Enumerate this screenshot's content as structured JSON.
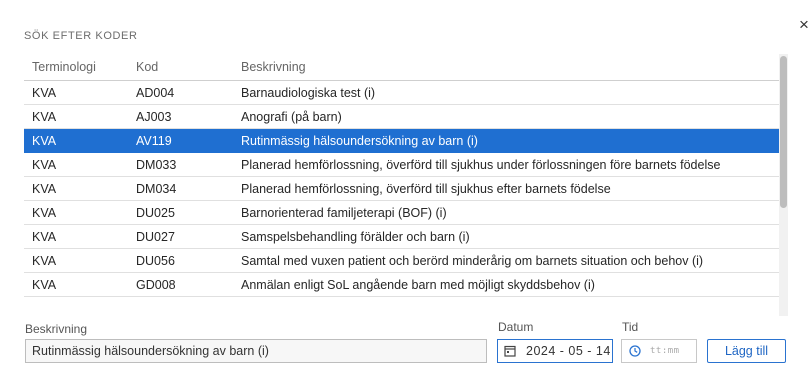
{
  "dialog": {
    "close_glyph": "×",
    "heading": "SÖK EFTER KODER"
  },
  "table": {
    "columns": [
      "Terminologi",
      "Kod",
      "Beskrivning"
    ],
    "selected_index": 2,
    "rows": [
      {
        "terminologi": "KVA",
        "kod": "AD004",
        "beskrivning": "Barnaudiologiska test (i)"
      },
      {
        "terminologi": "KVA",
        "kod": "AJ003",
        "beskrivning": "Anografi (på barn)"
      },
      {
        "terminologi": "KVA",
        "kod": "AV119",
        "beskrivning": "Rutinmässig hälsoundersökning av barn (i)"
      },
      {
        "terminologi": "KVA",
        "kod": "DM033",
        "beskrivning": "Planerad hemförlossning, överförd till sjukhus under förlossningen före barnets födelse"
      },
      {
        "terminologi": "KVA",
        "kod": "DM034",
        "beskrivning": "Planerad hemförlossning, överförd till sjukhus efter barnets födelse"
      },
      {
        "terminologi": "KVA",
        "kod": "DU025",
        "beskrivning": "Barnorienterad familjeterapi (BOF) (i)"
      },
      {
        "terminologi": "KVA",
        "kod": "DU027",
        "beskrivning": "Samspelsbehandling förälder och barn (i)"
      },
      {
        "terminologi": "KVA",
        "kod": "DU056",
        "beskrivning": "Samtal med vuxen patient och berörd minderårig om barnets situation och behov (i)"
      },
      {
        "terminologi": "KVA",
        "kod": "GD008",
        "beskrivning": "Anmälan enligt SoL angående barn med möjligt skyddsbehov (i)"
      }
    ]
  },
  "form": {
    "description_label": "Beskrivning",
    "description_value": "Rutinmässig hälsoundersökning av barn (i)",
    "date_label": "Datum",
    "date_value": "2024-05-14",
    "date_icon": "calendar-icon",
    "time_label": "Tid",
    "time_placeholder": "tt:mm",
    "time_icon": "clock-icon",
    "add_button": "Lägg till"
  },
  "colors": {
    "selected_row": "#1f6fd1",
    "accent": "#2a73d0"
  }
}
